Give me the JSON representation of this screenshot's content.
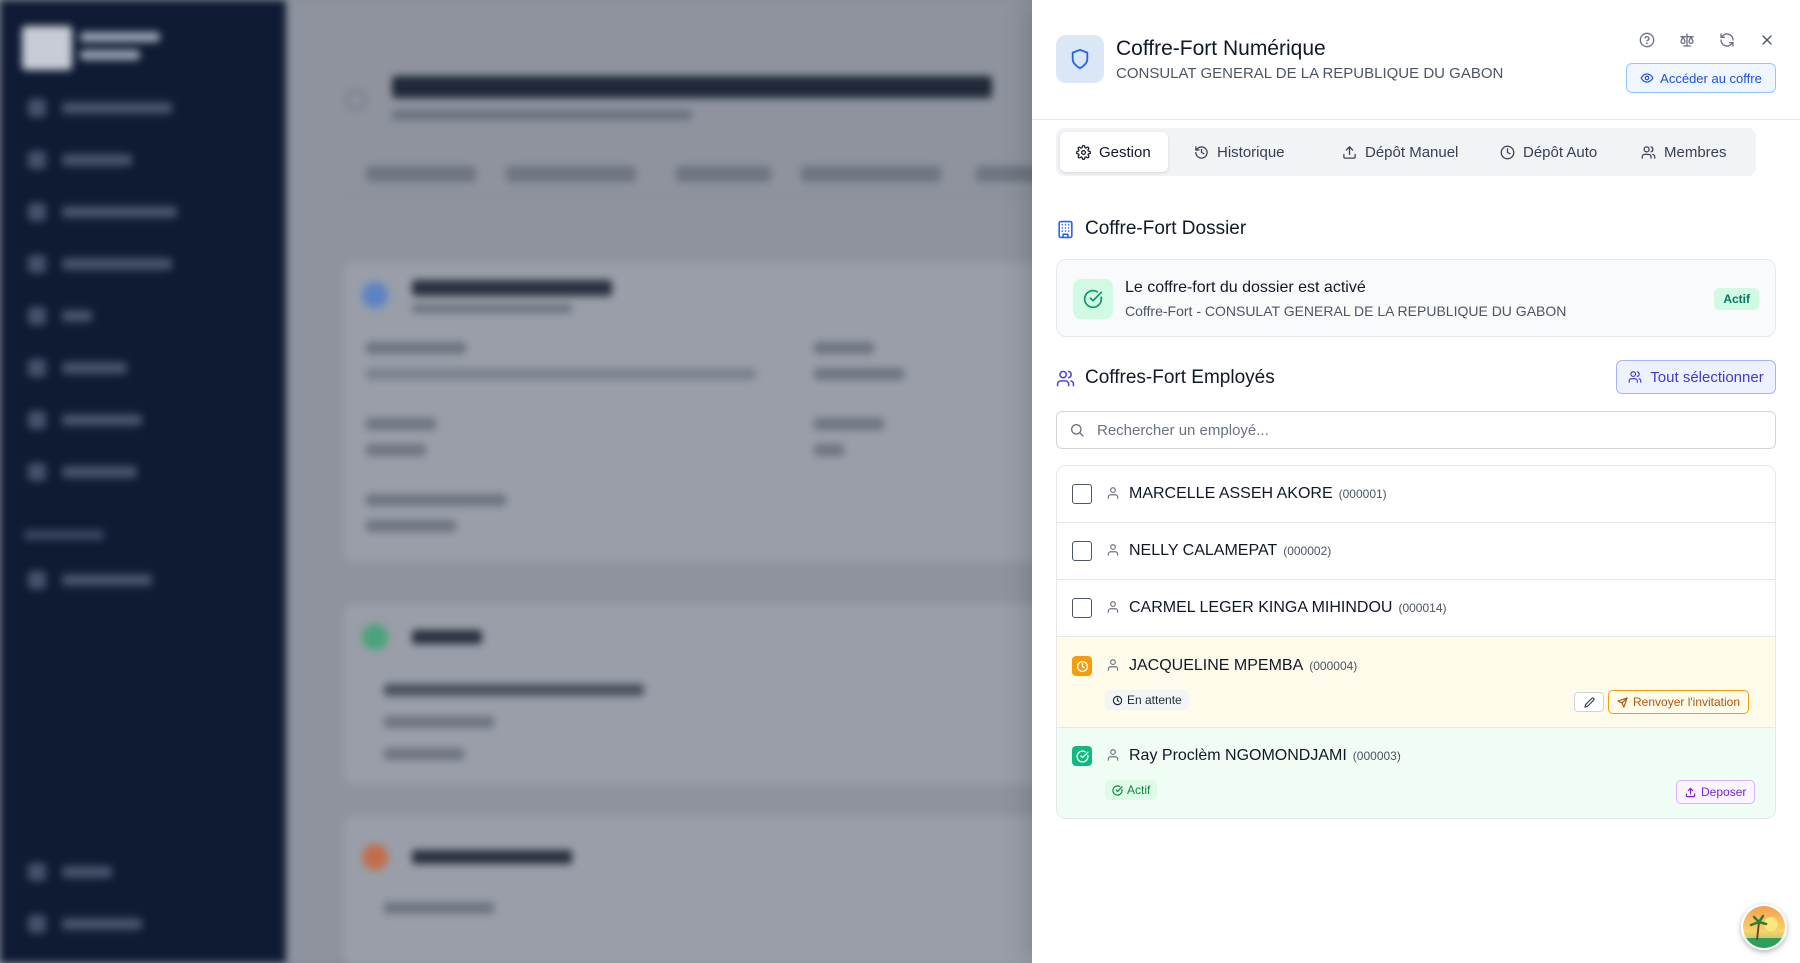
{
  "panel": {
    "title": "Coffre-Fort Numérique",
    "subtitle": "CONSULAT GENERAL DE LA REPUBLIQUE DU GABON",
    "access_button": "Accéder au coffre",
    "header_icons": [
      "help-circle-icon",
      "scale-icon",
      "refresh-icon",
      "close-icon"
    ]
  },
  "tabs": [
    {
      "label": "Gestion",
      "icon": "gear-icon",
      "active": true
    },
    {
      "label": "Historique",
      "icon": "history-icon",
      "active": false
    },
    {
      "label": "Dépôt Manuel",
      "icon": "upload-icon",
      "active": false
    },
    {
      "label": "Dépôt Auto",
      "icon": "clock-icon",
      "active": false
    },
    {
      "label": "Membres",
      "icon": "users-icon",
      "active": false
    }
  ],
  "dossier": {
    "section_title": "Coffre-Fort Dossier",
    "status_title": "Le coffre-fort du dossier est activé",
    "status_subtitle": "Coffre-Fort - CONSULAT GENERAL DE LA REPUBLIQUE DU GABON",
    "badge": "Actif"
  },
  "employees": {
    "section_title": "Coffres-Fort Employés",
    "select_all": "Tout sélectionner",
    "search_placeholder": "Rechercher un employé...",
    "list": [
      {
        "name": "MARCELLE ASSEH AKORE",
        "id": "(000001)",
        "state": "none"
      },
      {
        "name": "NELLY CALAMEPAT",
        "id": "(000002)",
        "state": "none"
      },
      {
        "name": "CARMEL LEGER KINGA MIHINDOU",
        "id": "(000014)",
        "state": "none"
      },
      {
        "name": "JACQUELINE MPEMBA",
        "id": "(000004)",
        "state": "pending",
        "status_label": "En attente",
        "action_label": "Renvoyer l'invitation"
      },
      {
        "name": "Ray Proclèm NGOMONDJAMI",
        "id": "(000003)",
        "state": "active",
        "status_label": "Actif",
        "action_label": "Deposer"
      }
    ]
  },
  "colors": {
    "sidebar_bg": "#0f1b33",
    "accent_blue": "#1d4ed8",
    "success_green": "#10b981",
    "pending_amber": "#f59e0b",
    "deposit_purple": "#7e22ce"
  }
}
